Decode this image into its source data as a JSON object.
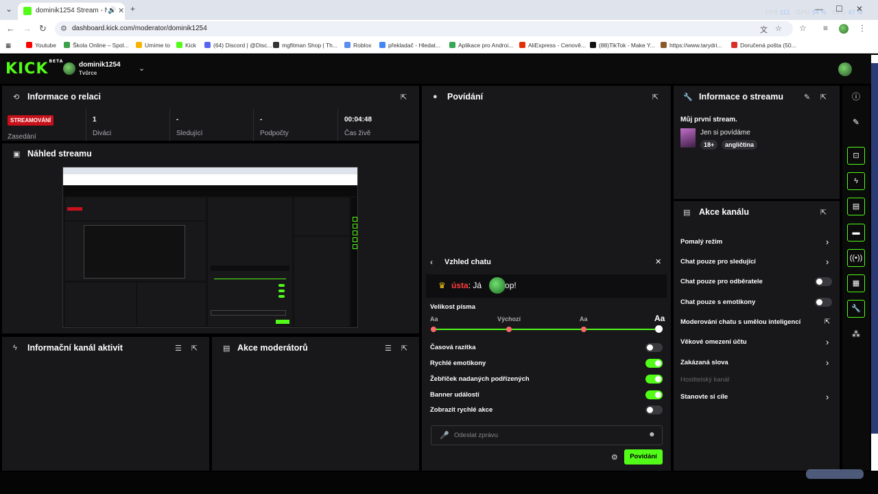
{
  "browser": {
    "tab_title": "dominik1254 Stream - Nást",
    "url": "dashboard.kick.com/moderator/dominik1254",
    "perf": {
      "fps_label": "FPS",
      "fps": "111",
      "gpu_label": "GPU",
      "gpu": "34 %",
      "cpu_label": "CPU",
      "cpu": "47 %"
    },
    "bookmarks": [
      {
        "label": "Youtube",
        "color": "#ff0000"
      },
      {
        "label": "Škola Online – Spol...",
        "color": "#3aa14a"
      },
      {
        "label": "Umíme to",
        "color": "#f6b400"
      },
      {
        "label": "Kick",
        "color": "#53fc18"
      },
      {
        "label": "(64) Discord | @Disc...",
        "color": "#5865f2"
      },
      {
        "label": "mgfitman Shop | Th...",
        "color": "#333333"
      },
      {
        "label": "Roblox",
        "color": "#5b8def"
      },
      {
        "label": "překladač - Hledat...",
        "color": "#4285f4"
      },
      {
        "label": "Aplikace pro Androi...",
        "color": "#34a853"
      },
      {
        "label": "AliExpress - Cenově...",
        "color": "#e62e04"
      },
      {
        "label": "(88)TikTok - Make Y...",
        "color": "#111111"
      },
      {
        "label": "https://www.tarydri...",
        "color": "#8b5a2b"
      },
      {
        "label": "Doručená pošta (50...",
        "color": "#d93025"
      }
    ]
  },
  "header": {
    "logo": "KICK",
    "beta": "BETA",
    "channel": "dominik1254",
    "role": "Tvůrce"
  },
  "session": {
    "title": "Informace o relaci",
    "live_badge": "STREAMOVÁNÍ",
    "session_label": "Zasedání",
    "stats": [
      {
        "value": "1",
        "label": "Diváci"
      },
      {
        "value": "-",
        "label": "Sledující"
      },
      {
        "value": "-",
        "label": "Podpočty"
      },
      {
        "value": "00:04:48",
        "label": "Čas živě"
      }
    ]
  },
  "preview": {
    "title": "Náhled streamu"
  },
  "activity": {
    "title": "Informační kanál aktivit"
  },
  "mod_actions": {
    "title": "Akce moderátorů"
  },
  "chat": {
    "title": "Povídání",
    "settings_title": "Vzhled chatu",
    "sample_user": "ústa",
    "sample_text_before": ": Já",
    "sample_text_after": "kop!",
    "font_size_label": "Velikost písma",
    "font_options": [
      "Aa",
      "Výchozí",
      "Aa",
      "Aa"
    ],
    "font_size_value": "3 of 4",
    "toggles": [
      {
        "label": "Časová razítka",
        "on": false
      },
      {
        "label": "Rychlé emotikony",
        "on": true
      },
      {
        "label": "Žebříček nadaných podřízených",
        "on": true
      },
      {
        "label": "Banner událostí",
        "on": true
      },
      {
        "label": "Zobrazit rychlé akce",
        "on": false
      }
    ],
    "placeholder": "Odeslat zprávu",
    "send_label": "Povídání"
  },
  "stream_info": {
    "title": "Informace o streamu",
    "stream_title": "Můj první stream.",
    "category": "Jen si povídáme",
    "tags": [
      "18+",
      "angličtina"
    ]
  },
  "channel_actions": {
    "title": "Akce kanálu",
    "items": [
      {
        "label": "Pomalý režim",
        "control": "arrow"
      },
      {
        "label": "Chat pouze pro sledující",
        "control": "arrow"
      },
      {
        "label": "Chat pouze pro odběratele",
        "control": "toggle"
      },
      {
        "label": "Chat pouze s emotikony",
        "control": "toggle"
      },
      {
        "label": "Moderování chatu s umělou inteligencí",
        "control": "external"
      },
      {
        "label": "Věkové omezení účtu",
        "control": "arrow"
      },
      {
        "label": "Zakázaná slova",
        "control": "arrow"
      },
      {
        "label": "Hostitelský kanál",
        "control": "disabled"
      },
      {
        "label": "Stanovte si cíle",
        "control": "arrow"
      }
    ]
  },
  "colors": {
    "accent": "#53fc18",
    "live": "#c8111a",
    "panel": "#18181b"
  }
}
